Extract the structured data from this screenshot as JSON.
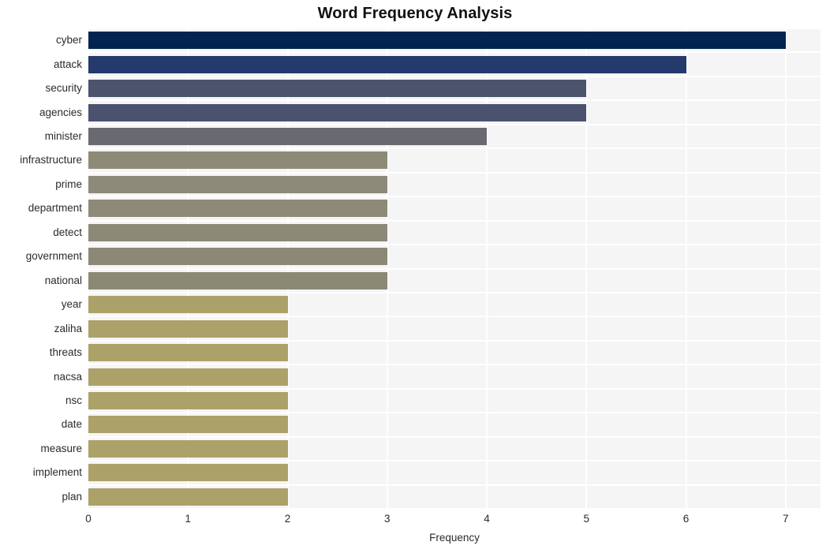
{
  "chart_data": {
    "type": "bar",
    "orientation": "horizontal",
    "title": "Word Frequency Analysis",
    "xlabel": "Frequency",
    "ylabel": "",
    "xlim": [
      0,
      7.35
    ],
    "xticks": [
      0,
      1,
      2,
      3,
      4,
      5,
      6,
      7
    ],
    "xtick_labels": [
      "0",
      "1",
      "2",
      "3",
      "4",
      "5",
      "6",
      "7"
    ],
    "grid": true,
    "grid_axis": "both",
    "grid_color": "#ffffff",
    "plot_background": "#f5f5f6",
    "figure_background": "#ffffff",
    "legend": null,
    "categories": [
      "cyber",
      "attack",
      "security",
      "agencies",
      "minister",
      "infrastructure",
      "prime",
      "department",
      "detect",
      "government",
      "national",
      "year",
      "zaliha",
      "threats",
      "nacsa",
      "nsc",
      "date",
      "measure",
      "implement",
      "plan"
    ],
    "values": [
      7,
      6,
      5,
      5,
      4,
      3,
      3,
      3,
      3,
      3,
      3,
      2,
      2,
      2,
      2,
      2,
      2,
      2,
      2,
      2
    ],
    "bar_colors": [
      "#022450",
      "#243a6c",
      "#4c536d",
      "#4b5270",
      "#696a71",
      "#8e8a78",
      "#8d8a79",
      "#8d8a78",
      "#8c8977",
      "#8c8876",
      "#8b8874",
      "#ada16a",
      "#ada16a",
      "#ada16a",
      "#ada16a",
      "#ada16a",
      "#ada16a",
      "#ada16a",
      "#ada16a",
      "#ada16a"
    ]
  }
}
